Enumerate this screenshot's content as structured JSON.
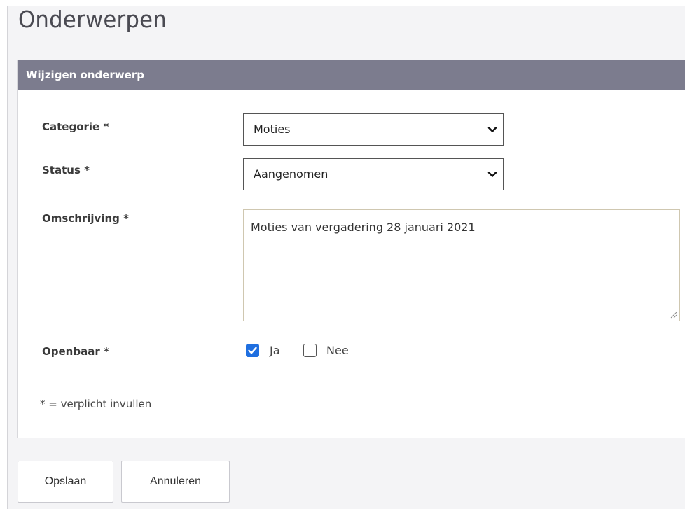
{
  "page": {
    "title": "Onderwerpen"
  },
  "panel": {
    "header": "Wijzigen onderwerp"
  },
  "form": {
    "categorie": {
      "label": "Categorie *",
      "selected": "Moties"
    },
    "status": {
      "label": "Status *",
      "selected": "Aangenomen"
    },
    "omschrijving": {
      "label": "Omschrijving *",
      "value": "Moties van vergadering 28 januari 2021"
    },
    "openbaar": {
      "label": "Openbaar *",
      "options": [
        {
          "label": "Ja",
          "checked": true
        },
        {
          "label": "Nee",
          "checked": false
        }
      ]
    },
    "footnote": "* = verplicht invullen"
  },
  "buttons": {
    "save": "Opslaan",
    "cancel": "Annuleren"
  },
  "colors": {
    "header_bg": "#7c7c8e",
    "checkbox_accent": "#1f6fe0",
    "background": "#f4f4f6"
  },
  "icons": {
    "select_chevron": "chevron-down-icon",
    "checkbox_check": "check-icon",
    "textarea_resize": "resize-grip-icon"
  }
}
